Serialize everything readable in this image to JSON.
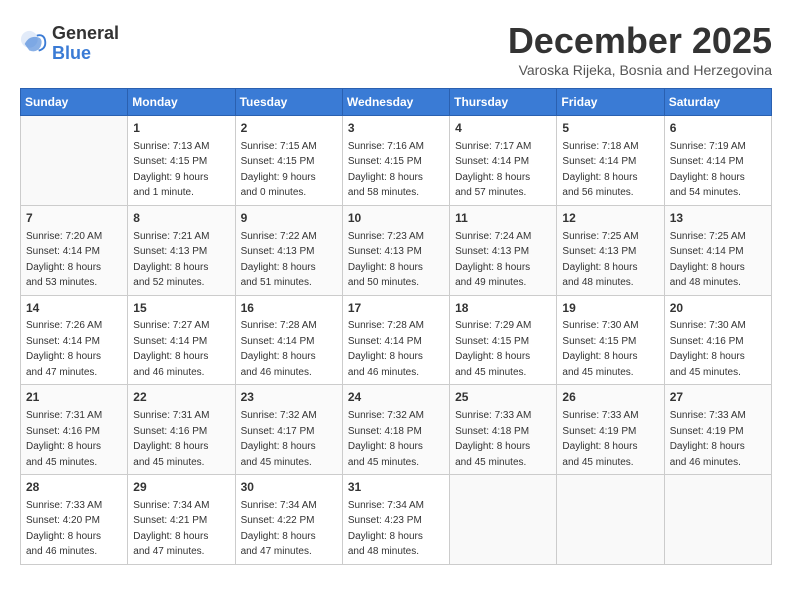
{
  "header": {
    "logo_general": "General",
    "logo_blue": "Blue",
    "month_year": "December 2025",
    "location": "Varoska Rijeka, Bosnia and Herzegovina"
  },
  "days_of_week": [
    "Sunday",
    "Monday",
    "Tuesday",
    "Wednesday",
    "Thursday",
    "Friday",
    "Saturday"
  ],
  "weeks": [
    [
      {
        "day": "",
        "info": ""
      },
      {
        "day": "1",
        "info": "Sunrise: 7:13 AM\nSunset: 4:15 PM\nDaylight: 9 hours\nand 1 minute."
      },
      {
        "day": "2",
        "info": "Sunrise: 7:15 AM\nSunset: 4:15 PM\nDaylight: 9 hours\nand 0 minutes."
      },
      {
        "day": "3",
        "info": "Sunrise: 7:16 AM\nSunset: 4:15 PM\nDaylight: 8 hours\nand 58 minutes."
      },
      {
        "day": "4",
        "info": "Sunrise: 7:17 AM\nSunset: 4:14 PM\nDaylight: 8 hours\nand 57 minutes."
      },
      {
        "day": "5",
        "info": "Sunrise: 7:18 AM\nSunset: 4:14 PM\nDaylight: 8 hours\nand 56 minutes."
      },
      {
        "day": "6",
        "info": "Sunrise: 7:19 AM\nSunset: 4:14 PM\nDaylight: 8 hours\nand 54 minutes."
      }
    ],
    [
      {
        "day": "7",
        "info": "Sunrise: 7:20 AM\nSunset: 4:14 PM\nDaylight: 8 hours\nand 53 minutes."
      },
      {
        "day": "8",
        "info": "Sunrise: 7:21 AM\nSunset: 4:13 PM\nDaylight: 8 hours\nand 52 minutes."
      },
      {
        "day": "9",
        "info": "Sunrise: 7:22 AM\nSunset: 4:13 PM\nDaylight: 8 hours\nand 51 minutes."
      },
      {
        "day": "10",
        "info": "Sunrise: 7:23 AM\nSunset: 4:13 PM\nDaylight: 8 hours\nand 50 minutes."
      },
      {
        "day": "11",
        "info": "Sunrise: 7:24 AM\nSunset: 4:13 PM\nDaylight: 8 hours\nand 49 minutes."
      },
      {
        "day": "12",
        "info": "Sunrise: 7:25 AM\nSunset: 4:13 PM\nDaylight: 8 hours\nand 48 minutes."
      },
      {
        "day": "13",
        "info": "Sunrise: 7:25 AM\nSunset: 4:14 PM\nDaylight: 8 hours\nand 48 minutes."
      }
    ],
    [
      {
        "day": "14",
        "info": "Sunrise: 7:26 AM\nSunset: 4:14 PM\nDaylight: 8 hours\nand 47 minutes."
      },
      {
        "day": "15",
        "info": "Sunrise: 7:27 AM\nSunset: 4:14 PM\nDaylight: 8 hours\nand 46 minutes."
      },
      {
        "day": "16",
        "info": "Sunrise: 7:28 AM\nSunset: 4:14 PM\nDaylight: 8 hours\nand 46 minutes."
      },
      {
        "day": "17",
        "info": "Sunrise: 7:28 AM\nSunset: 4:14 PM\nDaylight: 8 hours\nand 46 minutes."
      },
      {
        "day": "18",
        "info": "Sunrise: 7:29 AM\nSunset: 4:15 PM\nDaylight: 8 hours\nand 45 minutes."
      },
      {
        "day": "19",
        "info": "Sunrise: 7:30 AM\nSunset: 4:15 PM\nDaylight: 8 hours\nand 45 minutes."
      },
      {
        "day": "20",
        "info": "Sunrise: 7:30 AM\nSunset: 4:16 PM\nDaylight: 8 hours\nand 45 minutes."
      }
    ],
    [
      {
        "day": "21",
        "info": "Sunrise: 7:31 AM\nSunset: 4:16 PM\nDaylight: 8 hours\nand 45 minutes."
      },
      {
        "day": "22",
        "info": "Sunrise: 7:31 AM\nSunset: 4:16 PM\nDaylight: 8 hours\nand 45 minutes."
      },
      {
        "day": "23",
        "info": "Sunrise: 7:32 AM\nSunset: 4:17 PM\nDaylight: 8 hours\nand 45 minutes."
      },
      {
        "day": "24",
        "info": "Sunrise: 7:32 AM\nSunset: 4:18 PM\nDaylight: 8 hours\nand 45 minutes."
      },
      {
        "day": "25",
        "info": "Sunrise: 7:33 AM\nSunset: 4:18 PM\nDaylight: 8 hours\nand 45 minutes."
      },
      {
        "day": "26",
        "info": "Sunrise: 7:33 AM\nSunset: 4:19 PM\nDaylight: 8 hours\nand 45 minutes."
      },
      {
        "day": "27",
        "info": "Sunrise: 7:33 AM\nSunset: 4:19 PM\nDaylight: 8 hours\nand 46 minutes."
      }
    ],
    [
      {
        "day": "28",
        "info": "Sunrise: 7:33 AM\nSunset: 4:20 PM\nDaylight: 8 hours\nand 46 minutes."
      },
      {
        "day": "29",
        "info": "Sunrise: 7:34 AM\nSunset: 4:21 PM\nDaylight: 8 hours\nand 47 minutes."
      },
      {
        "day": "30",
        "info": "Sunrise: 7:34 AM\nSunset: 4:22 PM\nDaylight: 8 hours\nand 47 minutes."
      },
      {
        "day": "31",
        "info": "Sunrise: 7:34 AM\nSunset: 4:23 PM\nDaylight: 8 hours\nand 48 minutes."
      },
      {
        "day": "",
        "info": ""
      },
      {
        "day": "",
        "info": ""
      },
      {
        "day": "",
        "info": ""
      }
    ]
  ]
}
